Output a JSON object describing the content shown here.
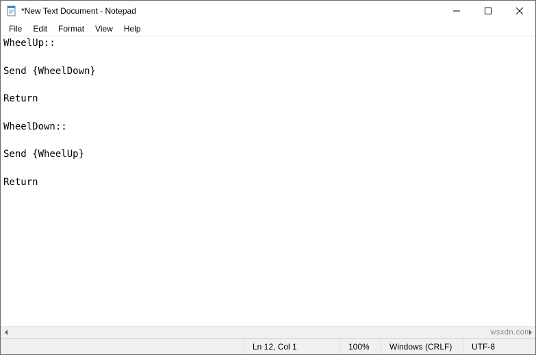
{
  "titlebar": {
    "icon_name": "notepad-icon",
    "title": "*New Text Document - Notepad"
  },
  "window_controls": {
    "minimize": "minimize-icon",
    "maximize": "maximize-icon",
    "close": "close-icon"
  },
  "menubar": {
    "items": [
      {
        "label": "File"
      },
      {
        "label": "Edit"
      },
      {
        "label": "Format"
      },
      {
        "label": "View"
      },
      {
        "label": "Help"
      }
    ]
  },
  "editor": {
    "text": "WheelUp::\n\nSend {WheelDown}\n\nReturn\n\nWheelDown::\n\nSend {WheelUp}\n\nReturn"
  },
  "statusbar": {
    "position": "Ln 12, Col 1",
    "zoom": "100%",
    "line_ending": "Windows (CRLF)",
    "encoding": "UTF-8"
  },
  "watermark": "wsxdn.com"
}
